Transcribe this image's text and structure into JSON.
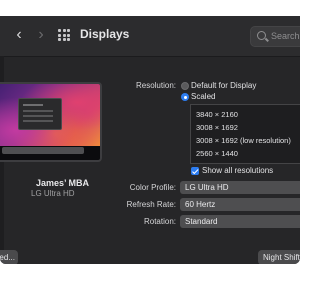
{
  "window": {
    "title": "Displays",
    "search_placeholder": "Search"
  },
  "icons": {
    "back": "chevron-left-icon",
    "forward": "chevron-right-icon",
    "grid": "grid-icon",
    "search": "search-icon"
  },
  "display": {
    "name": "James’ MBA",
    "model": "LG Ultra HD",
    "left_button_label": "ed..."
  },
  "resolution": {
    "label": "Resolution:",
    "options": [
      "Default for Display",
      "Scaled"
    ],
    "selected": "Scaled",
    "scaled_list": [
      "3840 × 2160",
      "3008 × 1692",
      "3008 × 1692 (low resolution)",
      "2560 × 1440"
    ],
    "show_all_label": "Show all resolutions",
    "show_all_checked": true
  },
  "color_profile": {
    "label": "Color Profile:",
    "value": "LG Ultra HD"
  },
  "refresh_rate": {
    "label": "Refresh Rate:",
    "value": "60 Hertz"
  },
  "rotation": {
    "label": "Rotation:",
    "value": "Standard"
  },
  "night_shift_button": "Night Shift...",
  "colors": {
    "window_bg": "#262628",
    "accent": "#2c7cf0"
  }
}
